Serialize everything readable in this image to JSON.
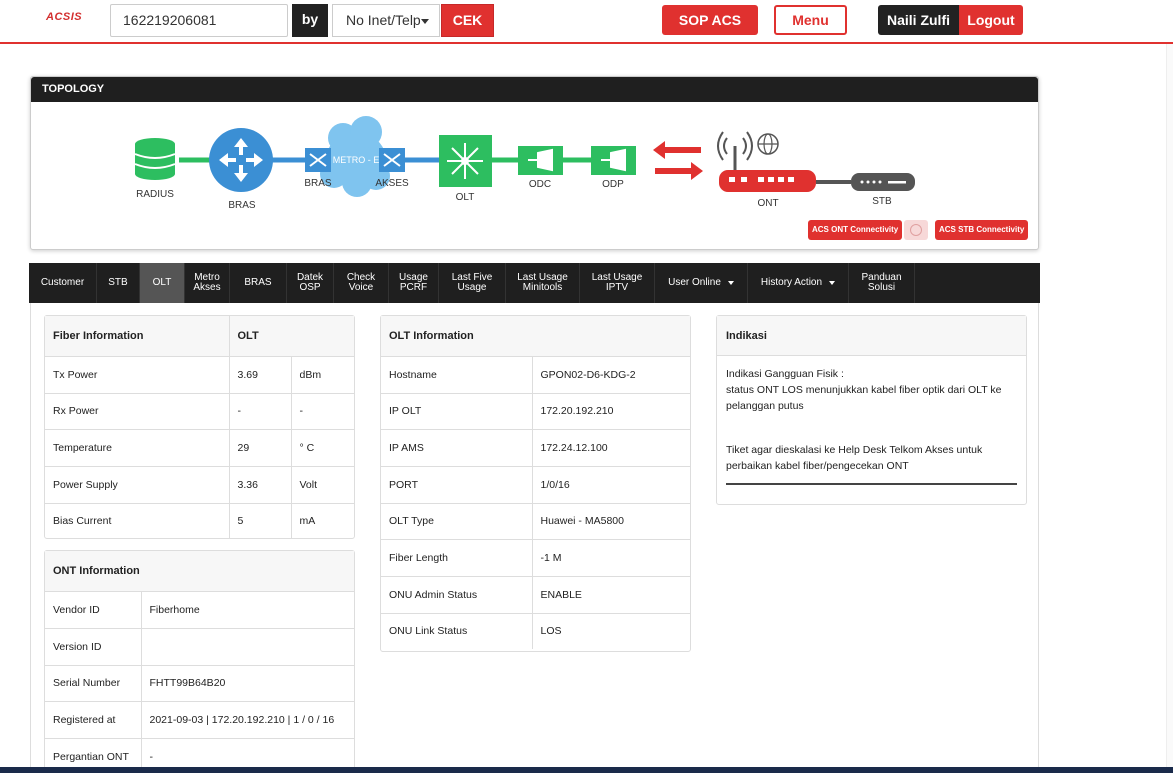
{
  "header": {
    "logo": "ACSIS",
    "search_value": "162219206081",
    "by_label": "by",
    "select_value": "No Inet/Telp",
    "cek_label": "CEK",
    "sop_label": "SOP ACS",
    "menu_label": "Menu",
    "user_name": "Naili Zulfi",
    "logout_label": "Logout"
  },
  "topology": {
    "title": "TOPOLOGY",
    "nodes": {
      "radius": "RADIUS",
      "bras": "BRAS",
      "metro": "METRO - E",
      "metro_bras": "BRAS",
      "metro_akses": "AKSES",
      "olt": "OLT",
      "odc": "ODC",
      "odp": "ODP",
      "ont": "ONT",
      "stb": "STB"
    },
    "acs_ont": "ACS ONT Connectivity",
    "acs_stb": "ACS STB Connectivity",
    "colors": {
      "green": "#2dbe60",
      "blue": "#3b8fd4",
      "cloud": "#7fc4ef",
      "red": "#e0312f",
      "gray": "#555555"
    }
  },
  "nav": {
    "tabs": [
      {
        "label": "Customer"
      },
      {
        "label": "STB"
      },
      {
        "label": "OLT",
        "active": true
      },
      {
        "label": "Metro\nAkses"
      },
      {
        "label": "BRAS"
      },
      {
        "label": "Datek\nOSP"
      },
      {
        "label": "Check\nVoice"
      },
      {
        "label": "Usage\nPCRF"
      },
      {
        "label": "Last Five\nUsage"
      },
      {
        "label": "Last Usage\nMinitools"
      },
      {
        "label": "Last Usage\nIPTV"
      },
      {
        "label": "User Online",
        "dropdown": true
      },
      {
        "label": "History Action",
        "dropdown": true
      },
      {
        "label": "Panduan\nSolusi"
      }
    ]
  },
  "fiber": {
    "header": [
      "Fiber Information",
      "OLT"
    ],
    "rows": [
      [
        "Tx Power",
        "3.69",
        "dBm"
      ],
      [
        "Rx Power",
        "-",
        "-"
      ],
      [
        "Temperature",
        "29",
        "° C"
      ],
      [
        "Power Supply",
        "3.36",
        "Volt"
      ],
      [
        "Bias Current",
        "5",
        "mA"
      ]
    ]
  },
  "ont": {
    "title": "ONT Information",
    "rows": [
      [
        "Vendor ID",
        "Fiberhome"
      ],
      [
        "Version ID",
        ""
      ],
      [
        "Serial Number",
        "FHTT99B64B20"
      ],
      [
        "Registered at",
        "2021-09-03 | 172.20.192.210 | 1 / 0 / 16"
      ],
      [
        "Pergantian ONT",
        "-"
      ]
    ]
  },
  "olt": {
    "title": "OLT Information",
    "rows": [
      [
        "Hostname",
        "GPON02-D6-KDG-2"
      ],
      [
        "IP OLT",
        "172.20.192.210"
      ],
      [
        "IP AMS",
        "172.24.12.100"
      ],
      [
        "PORT",
        "1/0/16"
      ],
      [
        "OLT Type",
        "Huawei - MA5800"
      ],
      [
        "Fiber Length",
        "-1 M"
      ],
      [
        "ONU Admin Status",
        "ENABLE"
      ],
      [
        "ONU Link Status",
        "LOS"
      ]
    ]
  },
  "indikasi": {
    "title": "Indikasi",
    "line1": "Indikasi Gangguan Fisik :",
    "line2": "status ONT LOS menunjukkan kabel fiber optik dari OLT ke pelanggan putus",
    "line3": "Tiket agar dieskalasi ke Help Desk Telkom Akses untuk perbaikan kabel fiber/pengecekan ONT"
  }
}
